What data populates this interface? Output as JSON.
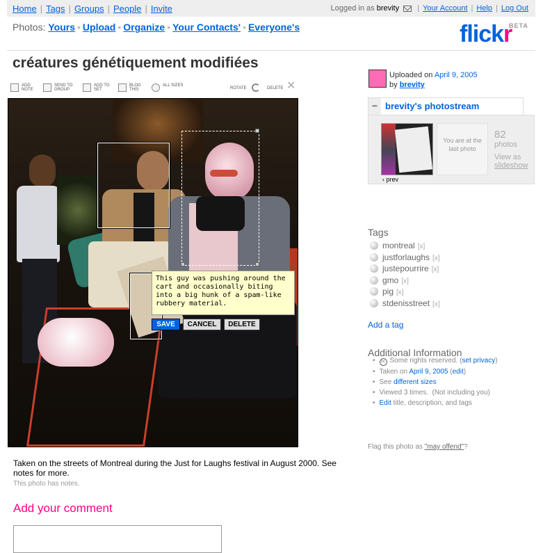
{
  "topnav": {
    "items": [
      "Home",
      "Tags",
      "Groups",
      "People",
      "Invite"
    ],
    "logged_in_prefix": "Logged in as",
    "username": "brevity",
    "links": [
      "Your Account",
      "Help",
      "Log Out"
    ]
  },
  "photos_nav": {
    "label": "Photos:",
    "items": [
      "Yours",
      "Upload",
      "Organize",
      "Your Contacts'",
      "Everyone's"
    ]
  },
  "logo": {
    "text_main": "flick",
    "text_accent": "r",
    "badge": "BETA"
  },
  "photo": {
    "title": "créatures génétiquement modifiées",
    "caption": "Taken on the streets of Montreal during the Just for Laughs festival in August 2000. See notes for more.",
    "has_notes": "This photo has notes."
  },
  "toolbar": {
    "add_note": "ADD NOTE",
    "send_to_group": "SEND TO GROUP",
    "add_to_set": "ADD TO SET",
    "blog_this": "BLOG THIS",
    "all_sizes": "ALL SIZES",
    "rotate": "ROTATE",
    "delete": "DELETE"
  },
  "note_editor": {
    "text": "This guy was pushing around the cart and occasionally biting into a big hunk of a spam-like rubbery material.",
    "save": "SAVE",
    "cancel": "CANCEL",
    "delete": "DELETE"
  },
  "comment": {
    "heading": "Add your comment"
  },
  "sidebar": {
    "uploaded_prefix": "Uploaded on",
    "uploaded_date": "April 9, 2005",
    "by_prefix": "by",
    "owner": "brevity",
    "photostream_title": "brevity's photostream",
    "prev": "‹ prev",
    "last_note": "You are at the last photo",
    "count": "82",
    "count_label": "photos",
    "view_as": "View as",
    "slideshow": "slideshow",
    "tags_heading": "Tags",
    "tags": [
      "montreal",
      "justforlaughs",
      "justepourrire",
      "gmo",
      "pig",
      "stdenisstreet"
    ],
    "tag_remove": "[x]",
    "add_tag": "Add a tag",
    "addinfo_heading": "Additional Information",
    "rights_text": "Some rights reserved.",
    "rights_link": "set privacy",
    "taken_prefix": "Taken on",
    "taken_date": "April 9, 2005",
    "taken_edit": "edit",
    "see_prefix": "See",
    "sizes_link": "different sizes",
    "viewed": "Viewed 3 times.",
    "viewed_note": "(Not including you)",
    "edit_link": "Edit",
    "edit_suffix": "title, description, and tags",
    "flag_prefix": "Flag this photo as",
    "flag_link": "\"may offend\"",
    "flag_suffix": "?"
  }
}
